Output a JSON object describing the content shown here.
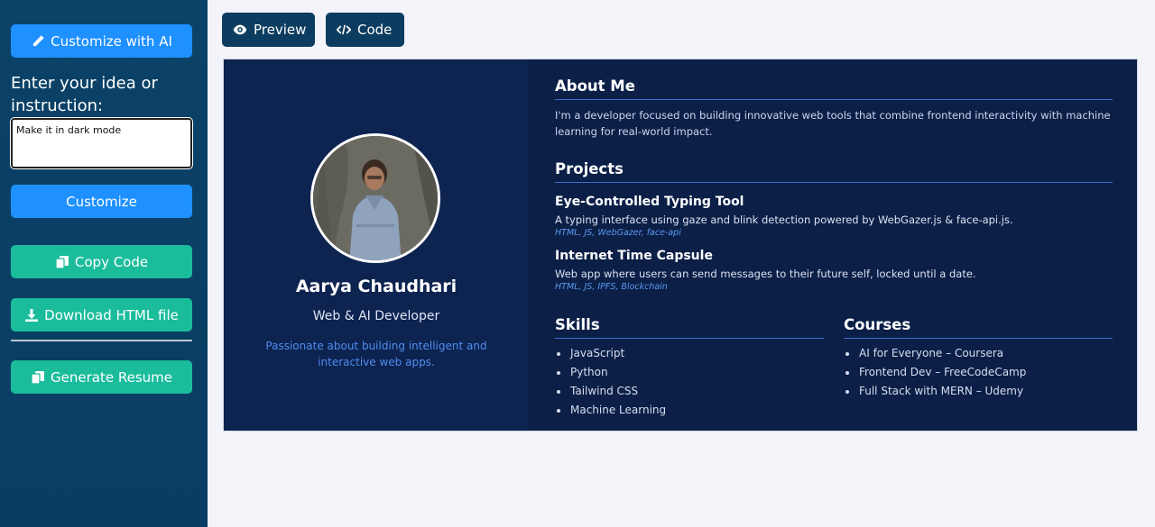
{
  "sidebar": {
    "customize_ai_label": "Customize with AI",
    "instruction_label": "Enter your idea or instruction:",
    "instruction_value": "Make it in dark mode",
    "customize_label": "Customize",
    "copy_code_label": "Copy Code",
    "download_label": "Download HTML file",
    "generate_resume_label": "Generate Resume"
  },
  "toolbar": {
    "preview_label": "Preview",
    "code_label": "Code"
  },
  "profile": {
    "name": "Aarya Chaudhari",
    "role": "Web & AI Developer",
    "tagline": "Passionate about building intelligent and interactive web apps."
  },
  "about": {
    "heading": "About Me",
    "text": "I'm a developer focused on building innovative web tools that combine frontend interactivity with machine learning for real-world impact."
  },
  "projects": {
    "heading": "Projects",
    "items": [
      {
        "title": "Eye-Controlled Typing Tool",
        "description": "A typing interface using gaze and blink detection powered by WebGazer.js & face-api.js.",
        "tags": "HTML, JS, WebGazer, face-api"
      },
      {
        "title": "Internet Time Capsule",
        "description": "Web app where users can send messages to their future self, locked until a date.",
        "tags": "HTML, JS, IPFS, Blockchain"
      }
    ]
  },
  "skills": {
    "heading": "Skills",
    "items": [
      "JavaScript",
      "Python",
      "Tailwind CSS",
      "Machine Learning"
    ]
  },
  "courses": {
    "heading": "Courses",
    "items": [
      "AI for Everyone – Coursera",
      "Frontend Dev – FreeCodeCamp",
      "Full Stack with MERN – Udemy"
    ]
  },
  "colors": {
    "sidebar_bg": "#0b4267",
    "primary_blue": "#1e90ff",
    "green": "#1abc9c",
    "dark_button": "#0c3d60",
    "card_bg": "#0b1f47",
    "accent_link": "#4f8ef0"
  },
  "icons": {
    "customize_ai": "pencil-icon",
    "copy_code": "copy-icon",
    "download": "download-icon",
    "generate_resume": "copy-icon",
    "preview": "eye-icon",
    "code": "code-icon"
  }
}
